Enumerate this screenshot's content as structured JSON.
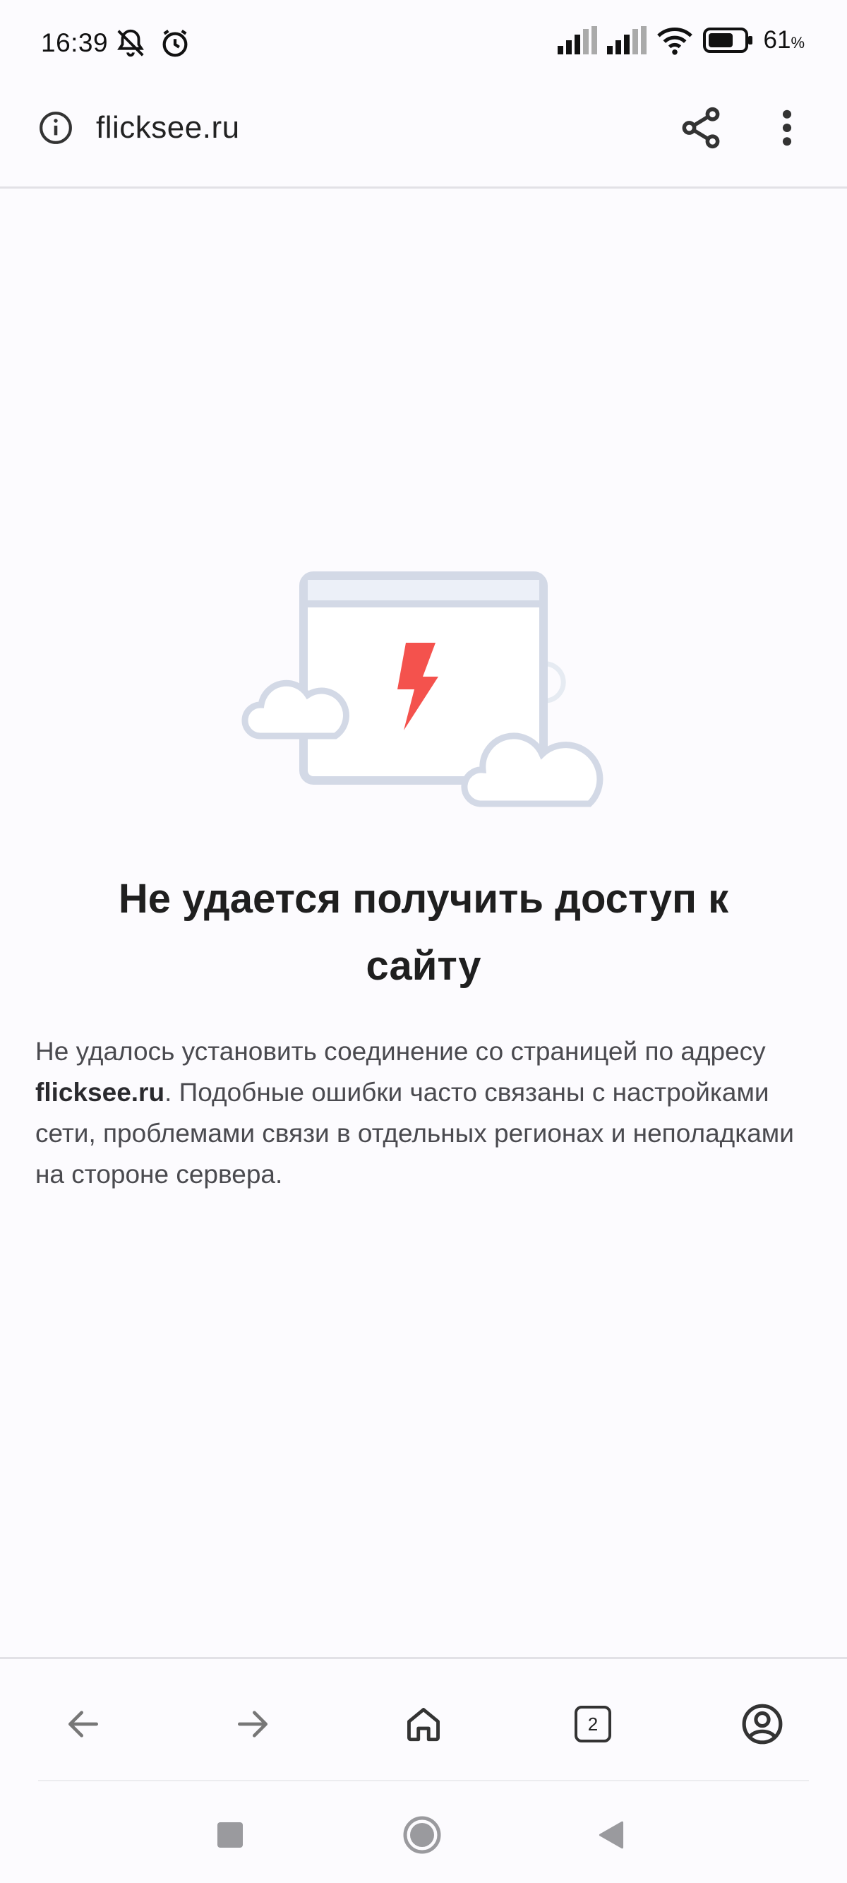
{
  "status_bar": {
    "time": "16:39",
    "battery_value": "61",
    "battery_unit": "%",
    "icons": [
      "bell-off-icon",
      "alarm-icon",
      "signal-icon",
      "signal-icon",
      "wifi-icon",
      "battery-icon"
    ]
  },
  "address_bar": {
    "url": "flicksee.ru",
    "icons": [
      "info-icon",
      "share-icon",
      "more-vert-icon"
    ]
  },
  "error": {
    "title": "Не удается получить доступ к сайту",
    "desc_prefix": "Не удалось установить соединение со страницей по адресу ",
    "desc_host": "flicksee.ru",
    "desc_suffix": ". Подобные ошибки часто связаны с настройками сети, проблемами связи в отдельных регионах и неполадками на стороне сервера.",
    "illustration_icon": "broken-page-icon"
  },
  "toolbar": {
    "tab_count": "2",
    "icons": [
      "back-arrow-icon",
      "forward-arrow-icon",
      "home-icon",
      "tabs-icon",
      "account-icon"
    ]
  },
  "nav_bar": {
    "icons": [
      "recents-icon",
      "home-circle-icon",
      "back-triangle-icon"
    ]
  },
  "colors": {
    "accent_red": "#f4524d",
    "illustration_stroke": "#d3d9e6",
    "background": "#fcfbfe"
  }
}
